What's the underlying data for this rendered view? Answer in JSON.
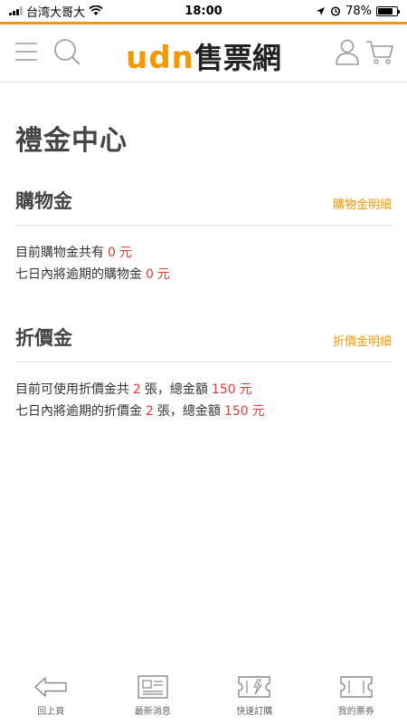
{
  "status_bar": {
    "carrier": "台湾大哥大",
    "time": "18:00",
    "battery": "78%",
    "battery_level": 0.78
  },
  "header": {
    "logo_brand": "udn",
    "logo_text": "售票網"
  },
  "page": {
    "title": "禮金中心"
  },
  "shopping_credit": {
    "title": "購物金",
    "detail_link": "購物金明細",
    "line1_prefix": "目前購物金共有",
    "line1_value": "0",
    "line1_unit": "元",
    "line2_prefix": "七日內將逾期的購物金",
    "line2_value": "0",
    "line2_unit": "元"
  },
  "discount": {
    "title": "折價金",
    "detail_link": "折價金明細",
    "line1_prefix": "目前可使用折價金共",
    "line1_count": "2",
    "line1_mid": "張，總金額",
    "line1_amount": "150",
    "line1_unit": "元",
    "line2_prefix": "七日內將逾期的折價金",
    "line2_count": "2",
    "line2_mid": "張，總金額",
    "line2_amount": "150",
    "line2_unit": "元"
  },
  "bottom_nav": {
    "items": [
      {
        "label": "回上頁",
        "icon": "back-arrow-icon"
      },
      {
        "label": "最新消息",
        "icon": "news-icon"
      },
      {
        "label": "快速訂購",
        "icon": "quick-ticket-icon"
      },
      {
        "label": "我的票券",
        "icon": "ticket-icon"
      }
    ]
  },
  "colors": {
    "accent": "#f39800",
    "highlight": "#e53935"
  }
}
